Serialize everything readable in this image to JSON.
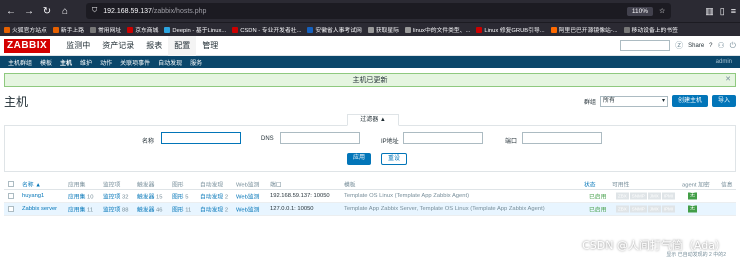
{
  "browser": {
    "url_host": "192.168.59.137",
    "url_path": "/zabbix/hosts.php",
    "zoom": "110%",
    "bookmarks": [
      "火狐官方站点",
      "新手上路",
      "常用网址",
      "京东商城",
      "Deepin - 基于Linux...",
      "CSDN - 专业开发者社...",
      "安徽省人事考试网",
      "获取星际",
      "linux中的文件类型、...",
      "Linux 修复GRUB引导...",
      "阿里巴巴开源镜像站-...",
      "移动设备上的书签"
    ]
  },
  "header": {
    "logo": "ZABBIX",
    "menu": [
      "监测中",
      "资产记录",
      "报表",
      "配置",
      "管理"
    ],
    "active_menu": "配置",
    "share": "Share",
    "help": "?"
  },
  "submenu": {
    "items": [
      "主机群组",
      "模板",
      "主机",
      "维护",
      "动作",
      "关联项事件",
      "自动发现",
      "服务"
    ],
    "active": "主机",
    "user": "admin"
  },
  "message": {
    "text": "主机已更新"
  },
  "page": {
    "title": "主机",
    "group_label": "群组",
    "group_value": "所有",
    "create_button": "创建主机",
    "import_button": "导入"
  },
  "filter": {
    "tab_label": "过滤器 ▲",
    "name_label": "名称",
    "dns_label": "DNS",
    "ip_label": "IP地址",
    "port_label": "端口",
    "apply": "应用",
    "reset": "重设"
  },
  "table": {
    "headers": [
      "名称 ▲",
      "应用集",
      "监控项",
      "触发器",
      "图形",
      "自动发现",
      "Web监测",
      "端口",
      "模板",
      "状态",
      "可用性",
      "agent 加密",
      "信息"
    ],
    "rows": [
      {
        "name": "huyang1",
        "apps": "应用集",
        "apps_n": "10",
        "items": "监控项",
        "items_n": "32",
        "triggers": "触发器",
        "triggers_n": "15",
        "graphs": "图形",
        "graphs_n": "5",
        "discovery": "自动发现",
        "discovery_n": "2",
        "web": "Web监测",
        "interface": "192.168.59.137: 10050",
        "templates": "Template OS Linux (Template App Zabbix Agent)",
        "status": "已启用",
        "avail": [
          "ZBX",
          "SNMP",
          "JMX",
          "IPMI"
        ],
        "encryption": "无"
      },
      {
        "name": "Zabbix server",
        "apps": "应用集",
        "apps_n": "11",
        "items": "监控项",
        "items_n": "88",
        "triggers": "触发器",
        "triggers_n": "46",
        "graphs": "图形",
        "graphs_n": "11",
        "discovery": "自动发现",
        "discovery_n": "2",
        "web": "Web监测",
        "interface": "127.0.0.1: 10050",
        "templates": "Template App Zabbix Server, Template OS Linux (Template App Zabbix Agent)",
        "status": "已启用",
        "avail": [
          "ZBX",
          "SNMP",
          "JMX",
          "IPMI"
        ],
        "encryption": "无"
      }
    ],
    "footer": "显示 已自动发现的 2 中的2"
  },
  "watermark": "CSDN @人间打气筒（Ada）"
}
